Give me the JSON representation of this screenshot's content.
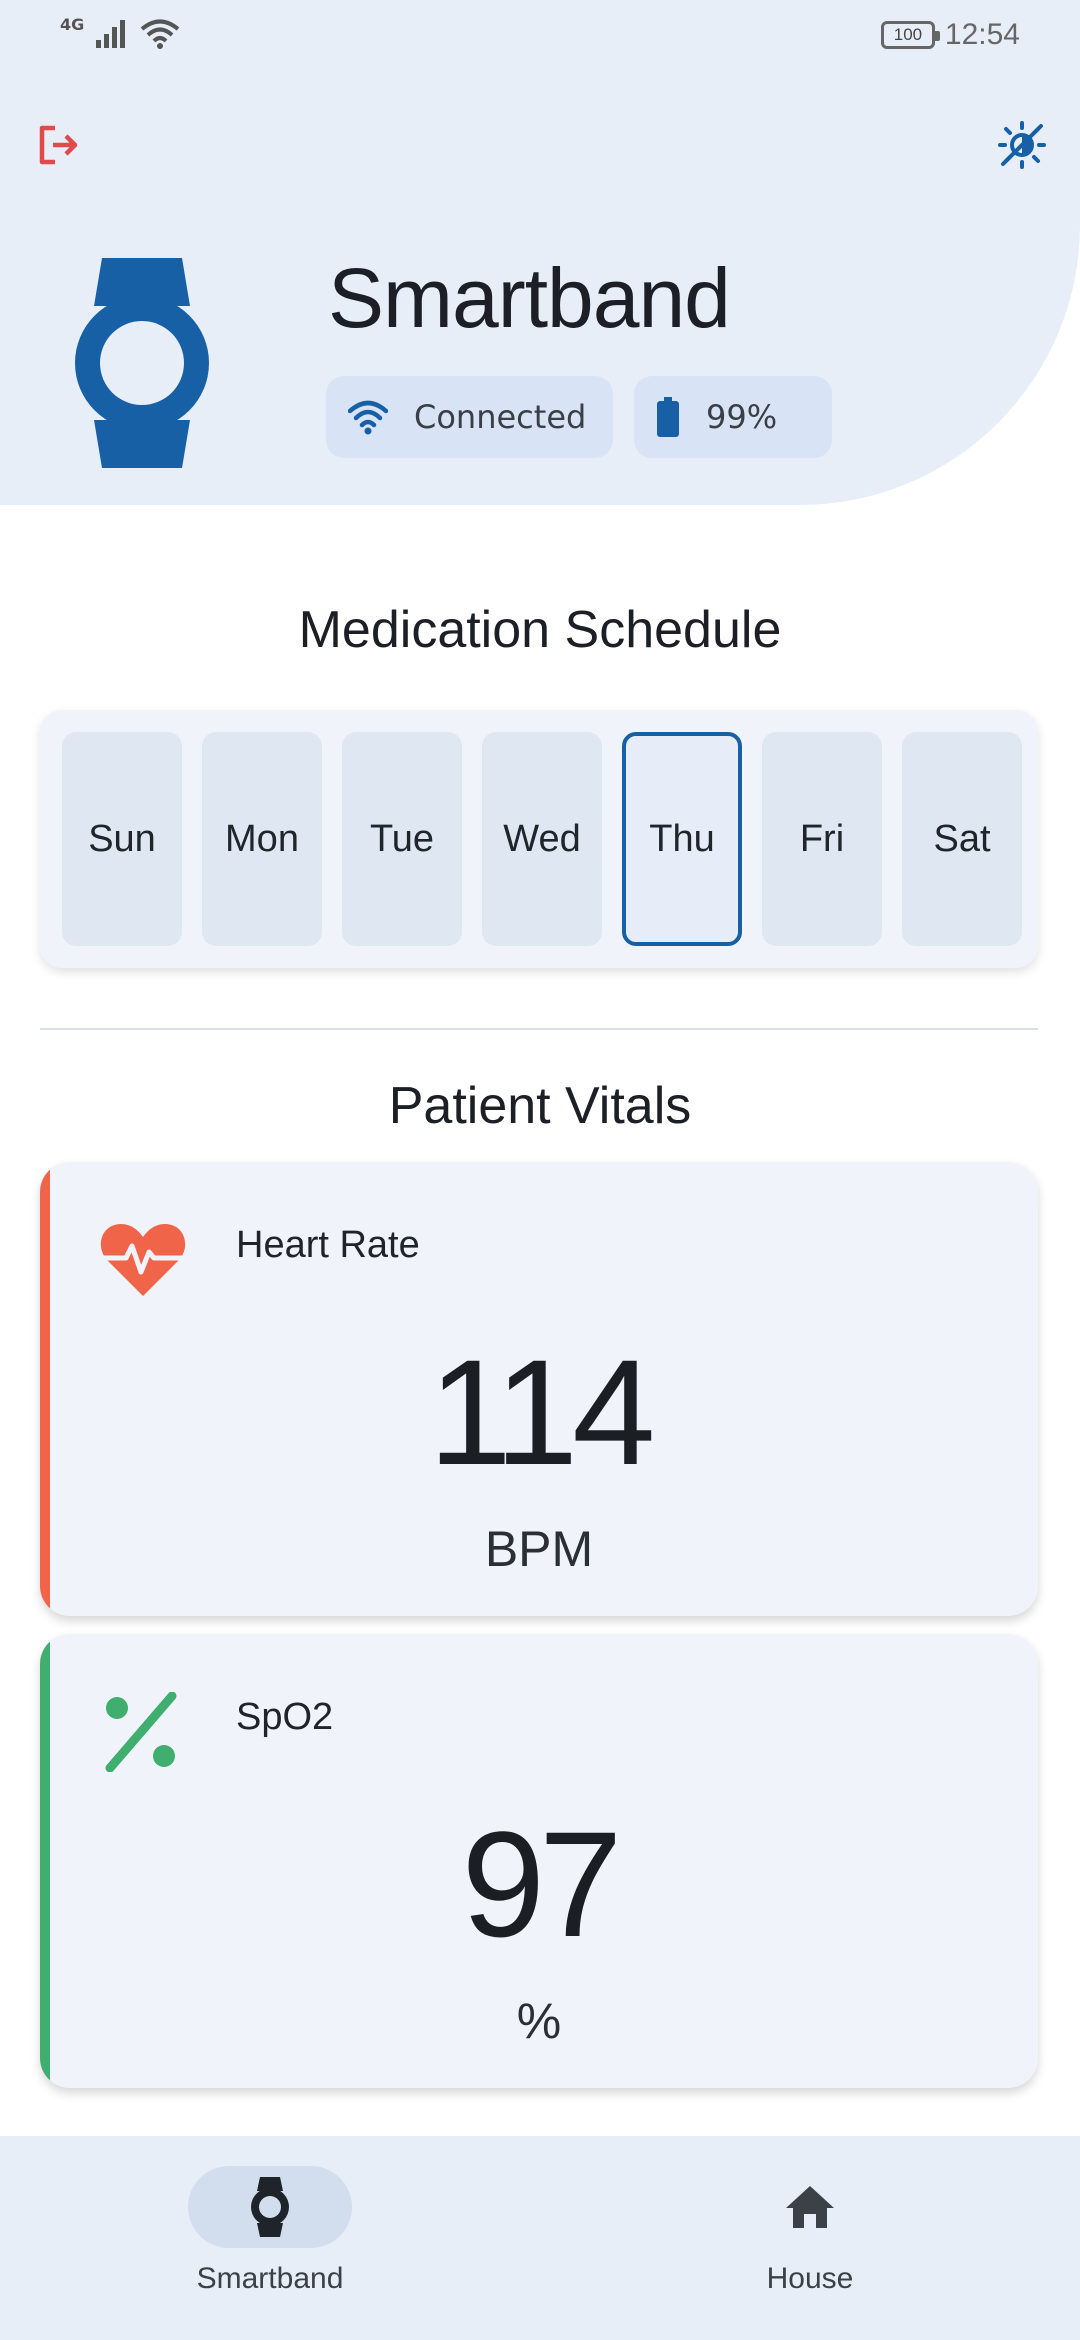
{
  "status_bar": {
    "network": "4G",
    "battery": "100",
    "time": "12:54"
  },
  "header": {
    "device_name": "Smartband",
    "connection_status": "Connected",
    "battery_level": "99%"
  },
  "medication": {
    "title": "Medication Schedule",
    "days": [
      "Sun",
      "Mon",
      "Tue",
      "Wed",
      "Thu",
      "Fri",
      "Sat"
    ],
    "selected_day": "Thu"
  },
  "vitals": {
    "title": "Patient Vitals",
    "heart_rate": {
      "label": "Heart Rate",
      "value": "114",
      "unit": "BPM"
    },
    "spo2": {
      "label": "SpO2",
      "value": "97",
      "unit": "%"
    }
  },
  "bottom_nav": {
    "items": [
      {
        "label": "Smartband",
        "icon": "watch-icon",
        "active": true
      },
      {
        "label": "House",
        "icon": "house-icon",
        "active": false
      }
    ]
  },
  "colors": {
    "primary": "#1760a6",
    "heart": "#f0654a",
    "spo2": "#3fae6e",
    "logout": "#e14a4a",
    "header_bg": "#e7eef8"
  }
}
